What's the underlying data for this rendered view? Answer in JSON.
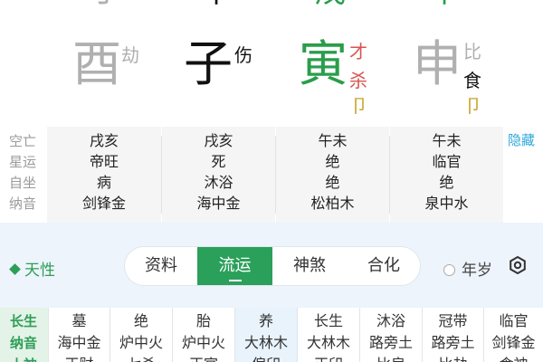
{
  "top_cut": [
    "丁",
    "甲",
    "戊",
    "甲"
  ],
  "branches": [
    {
      "char": "酉",
      "color": "#b0b0b0",
      "relation": [
        "劫"
      ],
      "rel_color": "#b0b0b0",
      "sub": ""
    },
    {
      "char": "子",
      "color": "#111111",
      "relation": [
        "伤"
      ],
      "rel_color": "#111111",
      "sub": ""
    },
    {
      "char": "寅",
      "color": "#2a9d4a",
      "relation": [
        "才",
        "杀"
      ],
      "rel_colors": [
        "#d9534f",
        "#d9534f"
      ],
      "sub": "卩"
    },
    {
      "char": "申",
      "color": "#b0b0b0",
      "relation": [
        "比",
        "食"
      ],
      "rel_colors": [
        "#b0b0b0",
        "#111111"
      ],
      "sub": "卩"
    }
  ],
  "pillar_table": {
    "labels": [
      "空亡",
      "星运",
      "自坐",
      "纳音"
    ],
    "columns": [
      [
        "戌亥",
        "帝旺",
        "病",
        "剑锋金"
      ],
      [
        "戌亥",
        "死",
        "沐浴",
        "海中金"
      ],
      [
        "午未",
        "绝",
        "绝",
        "松柏木"
      ],
      [
        "午未",
        "临官",
        "绝",
        "泉中水"
      ]
    ],
    "hide_label": "隐藏"
  },
  "tianxing": "天性",
  "tabs": [
    "资料",
    "流运",
    "神煞",
    "合化"
  ],
  "active_tab": 1,
  "liunian_label": "年岁",
  "bottom_table": {
    "labels": [
      "长生",
      "纳音",
      "十神"
    ],
    "columns": [
      [
        "墓",
        "海中金",
        "正财"
      ],
      [
        "绝",
        "炉中火",
        "七杀"
      ],
      [
        "胎",
        "炉中火",
        "正官"
      ],
      [
        "养",
        "大林木",
        "偏印"
      ],
      [
        "长生",
        "大林木",
        "正印"
      ],
      [
        "沐浴",
        "路旁土",
        "比肩"
      ],
      [
        "冠带",
        "路旁土",
        "比劫"
      ],
      [
        "临官",
        "剑锋金",
        "食神"
      ]
    ],
    "highlight_index": 3
  },
  "colors": {
    "accent_green": "#2aa05a",
    "link_blue": "#2ea7d8",
    "band_blue": "#edf4fb"
  }
}
